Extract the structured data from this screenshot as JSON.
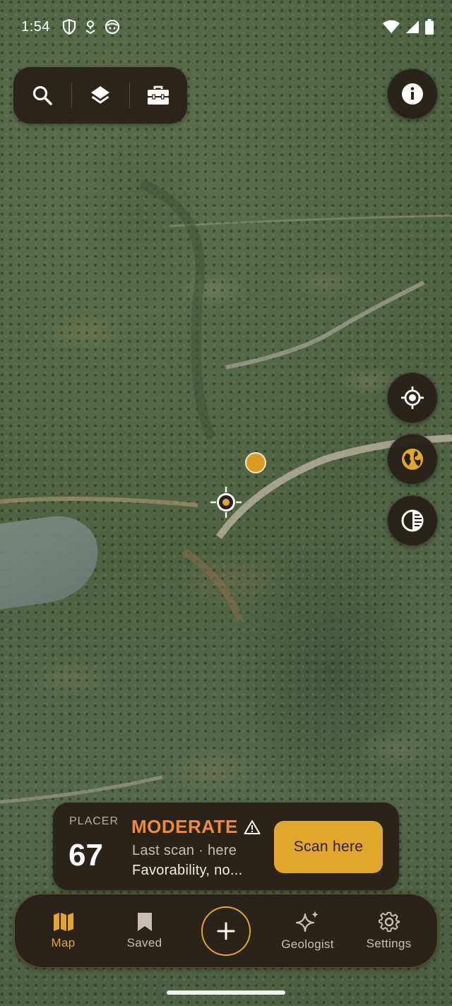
{
  "status_bar": {
    "time": "1:54",
    "left_icons": [
      "shield-icon",
      "location-pin-icon",
      "face-icon"
    ],
    "right_icons": [
      "wifi-icon",
      "cell-signal-icon",
      "battery-icon"
    ]
  },
  "toolbar": {
    "buttons": [
      {
        "icon": "search-icon"
      },
      {
        "icon": "layers-icon"
      },
      {
        "icon": "toolbox-icon"
      }
    ]
  },
  "map_controls": {
    "info": {
      "icon": "info-icon"
    },
    "locate": {
      "icon": "my-location-icon"
    },
    "globe": {
      "icon": "globe-icon"
    },
    "contrast": {
      "icon": "contrast-icon"
    }
  },
  "info_card": {
    "deposit_type": "PLACER",
    "score": "67",
    "level": "MODERATE",
    "warning_icon": "warning-icon",
    "last_scan": "Last scan · here",
    "description": "Favorability, no...",
    "scan_button": "Scan here"
  },
  "bottom_nav": {
    "items": [
      {
        "label": "Map",
        "icon": "map-icon",
        "active": true
      },
      {
        "label": "Saved",
        "icon": "bookmark-icon",
        "active": false
      },
      {
        "label": "",
        "icon": "plus-icon",
        "active": false
      },
      {
        "label": "Geologist",
        "icon": "sparkles-icon",
        "active": false
      },
      {
        "label": "Settings",
        "icon": "gear-icon",
        "active": false
      }
    ]
  },
  "colors": {
    "accent": "#e3a62d",
    "level_moderate": "#ef8b3a",
    "panel_bg": "#282118"
  }
}
